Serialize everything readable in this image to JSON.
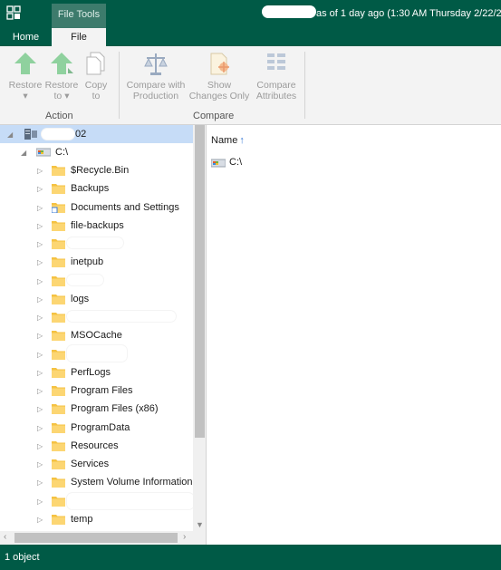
{
  "titlebar": {
    "context_tab": "File Tools",
    "title_suffix": "as of 1 day ago (1:30 AM Thursday 2/22/202"
  },
  "tabs": [
    {
      "label": "Home",
      "active": false
    },
    {
      "label": "File",
      "active": true
    }
  ],
  "ribbon": {
    "groups": [
      {
        "label": "Action"
      },
      {
        "label": "Compare"
      }
    ],
    "buttons": [
      {
        "label": "Restore",
        "label2": "▾",
        "icon": "green-up-arrow-icon",
        "enabled": false
      },
      {
        "label": "Restore",
        "label2": "to ▾",
        "icon": "green-up-arrow-icon",
        "enabled": false
      },
      {
        "label": "Copy",
        "label2": "to",
        "icon": "copy-document-icon",
        "enabled": false
      },
      {
        "label": "Compare with",
        "label2": "Production",
        "icon": "scales-icon",
        "enabled": false
      },
      {
        "label": "Show",
        "label2": "Changes Only",
        "icon": "changes-folder-icon",
        "enabled": false
      },
      {
        "label": "Compare",
        "label2": "Attributes",
        "icon": "attributes-list-icon",
        "enabled": false
      }
    ]
  },
  "tree": {
    "root": {
      "label_suffix": "02",
      "icon": "server-icon"
    },
    "drive": {
      "label": "C:\\",
      "icon": "drive-icon"
    },
    "folders": [
      {
        "label": "$Recycle.Bin"
      },
      {
        "label": "Backups"
      },
      {
        "label": "Documents and Settings",
        "shortcut": true
      },
      {
        "label": "file-backups"
      },
      {
        "label": ""
      },
      {
        "label": "inetpub"
      },
      {
        "label": ""
      },
      {
        "label": "logs"
      },
      {
        "label": ""
      },
      {
        "label": "MSOCache"
      },
      {
        "label": ""
      },
      {
        "label": "PerfLogs"
      },
      {
        "label": "Program Files"
      },
      {
        "label": "Program Files (x86)"
      },
      {
        "label": "ProgramData"
      },
      {
        "label": "Resources"
      },
      {
        "label": "Services"
      },
      {
        "label": "System Volume Information"
      },
      {
        "label": ""
      },
      {
        "label": "temp"
      }
    ]
  },
  "list": {
    "column_name": "Name",
    "sort_indicator": "↑",
    "items": [
      {
        "label": "C:\\",
        "icon": "drive-icon"
      }
    ]
  },
  "statusbar": {
    "text": "1 object"
  },
  "colors": {
    "brand_green": "#005a46",
    "selection": "#c6dcf7",
    "folder": "#f5c242",
    "disabled_text": "#9b9b9b"
  }
}
